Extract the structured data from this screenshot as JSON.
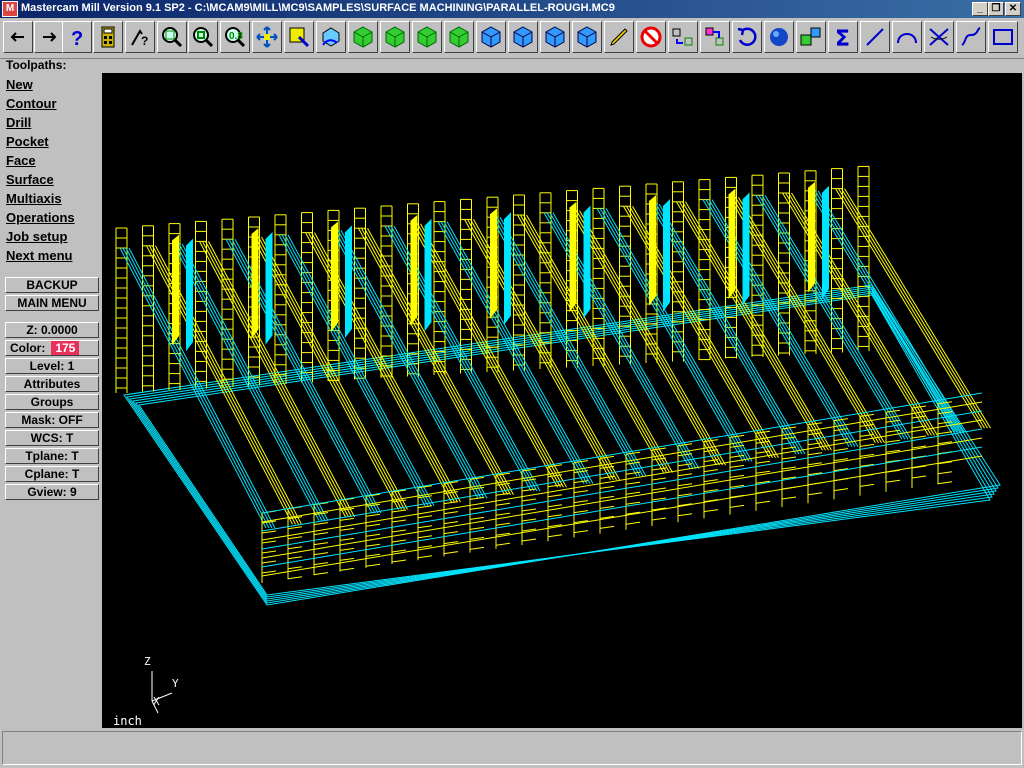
{
  "window": {
    "title": "Mastercam Mill Version 9.1 SP2 - C:\\MCAM9\\MILL\\MC9\\SAMPLES\\SURFACE MACHINING\\PARALLEL-ROUGH.MC9",
    "icon_text": "M",
    "minimize": "_",
    "restore": "❐",
    "close": "✕"
  },
  "toolbar": {
    "icons": [
      "arrow-left-icon",
      "arrow-right-icon",
      "help-icon",
      "calculator-icon",
      "analyze-icon",
      "zoom-window-icon",
      "zoom-out-icon",
      "zoom-in-icon",
      "pan-icon",
      "screen-select-icon",
      "rotate-icon",
      "view-top-icon",
      "view-front-icon",
      "view-side-icon",
      "view-iso-icon",
      "shaded-top-icon",
      "shaded-front-icon",
      "shaded-side-icon",
      "shaded-iso-icon",
      "pencil-icon",
      "no-entry-icon",
      "transform-icon",
      "translate-icon",
      "undo-icon",
      "sphere-icon",
      "copy-icon",
      "sum-icon",
      "line-icon",
      "arc-icon",
      "trim-icon",
      "spline-icon",
      "rectangle-icon"
    ]
  },
  "menu": {
    "header": "Toolpaths:",
    "items": [
      "New",
      "Contour",
      "Drill",
      "Pocket",
      "Face",
      "Surface",
      "Multiaxis",
      "Operations",
      "Job setup",
      "Next menu"
    ],
    "backup": "BACKUP",
    "main_menu": "MAIN MENU"
  },
  "status_panel": {
    "z": "Z:  0.0000",
    "color_label": "Color:",
    "color_value": "175",
    "level": "Level:   1",
    "attributes": "Attributes",
    "groups": "Groups",
    "mask": "Mask:  OFF",
    "wcs": "WCS:   T",
    "tplane": "Tplane:   T",
    "cplane": "Cplane:   T",
    "gview": "Gview:   9"
  },
  "viewport": {
    "units": "inch",
    "axis_z": "Z",
    "axis_y": "Y",
    "axis_x": "X",
    "colors": {
      "wire_yellow": "#ffff00",
      "wire_cyan": "#00e5ff",
      "background": "#000000"
    }
  }
}
